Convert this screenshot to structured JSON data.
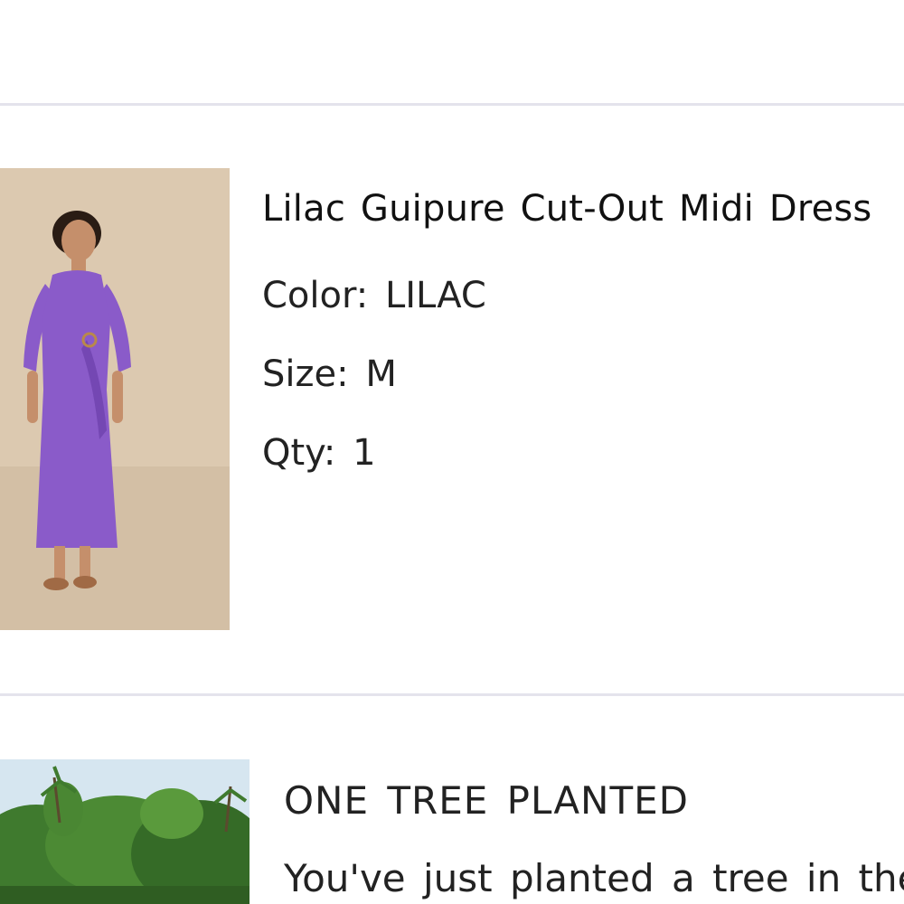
{
  "product": {
    "title": "Lilac Guipure Cut-Out Midi Dress",
    "color_label": "Color:",
    "color_value": "LILAC",
    "size_label": "Size:",
    "size_value": "M",
    "qty_label": "Qty:",
    "qty_value": "1",
    "image_icon": "dress-photo",
    "dress_color": "#8a5bc9",
    "backdrop_color": "#d9c6ad"
  },
  "tree": {
    "heading": "ONE TREE PLANTED",
    "body": "You've just planted a tree in the",
    "image_icon": "forest-photo",
    "foliage_color": "#3d7a2f",
    "sky_color": "#cfe2ee"
  }
}
